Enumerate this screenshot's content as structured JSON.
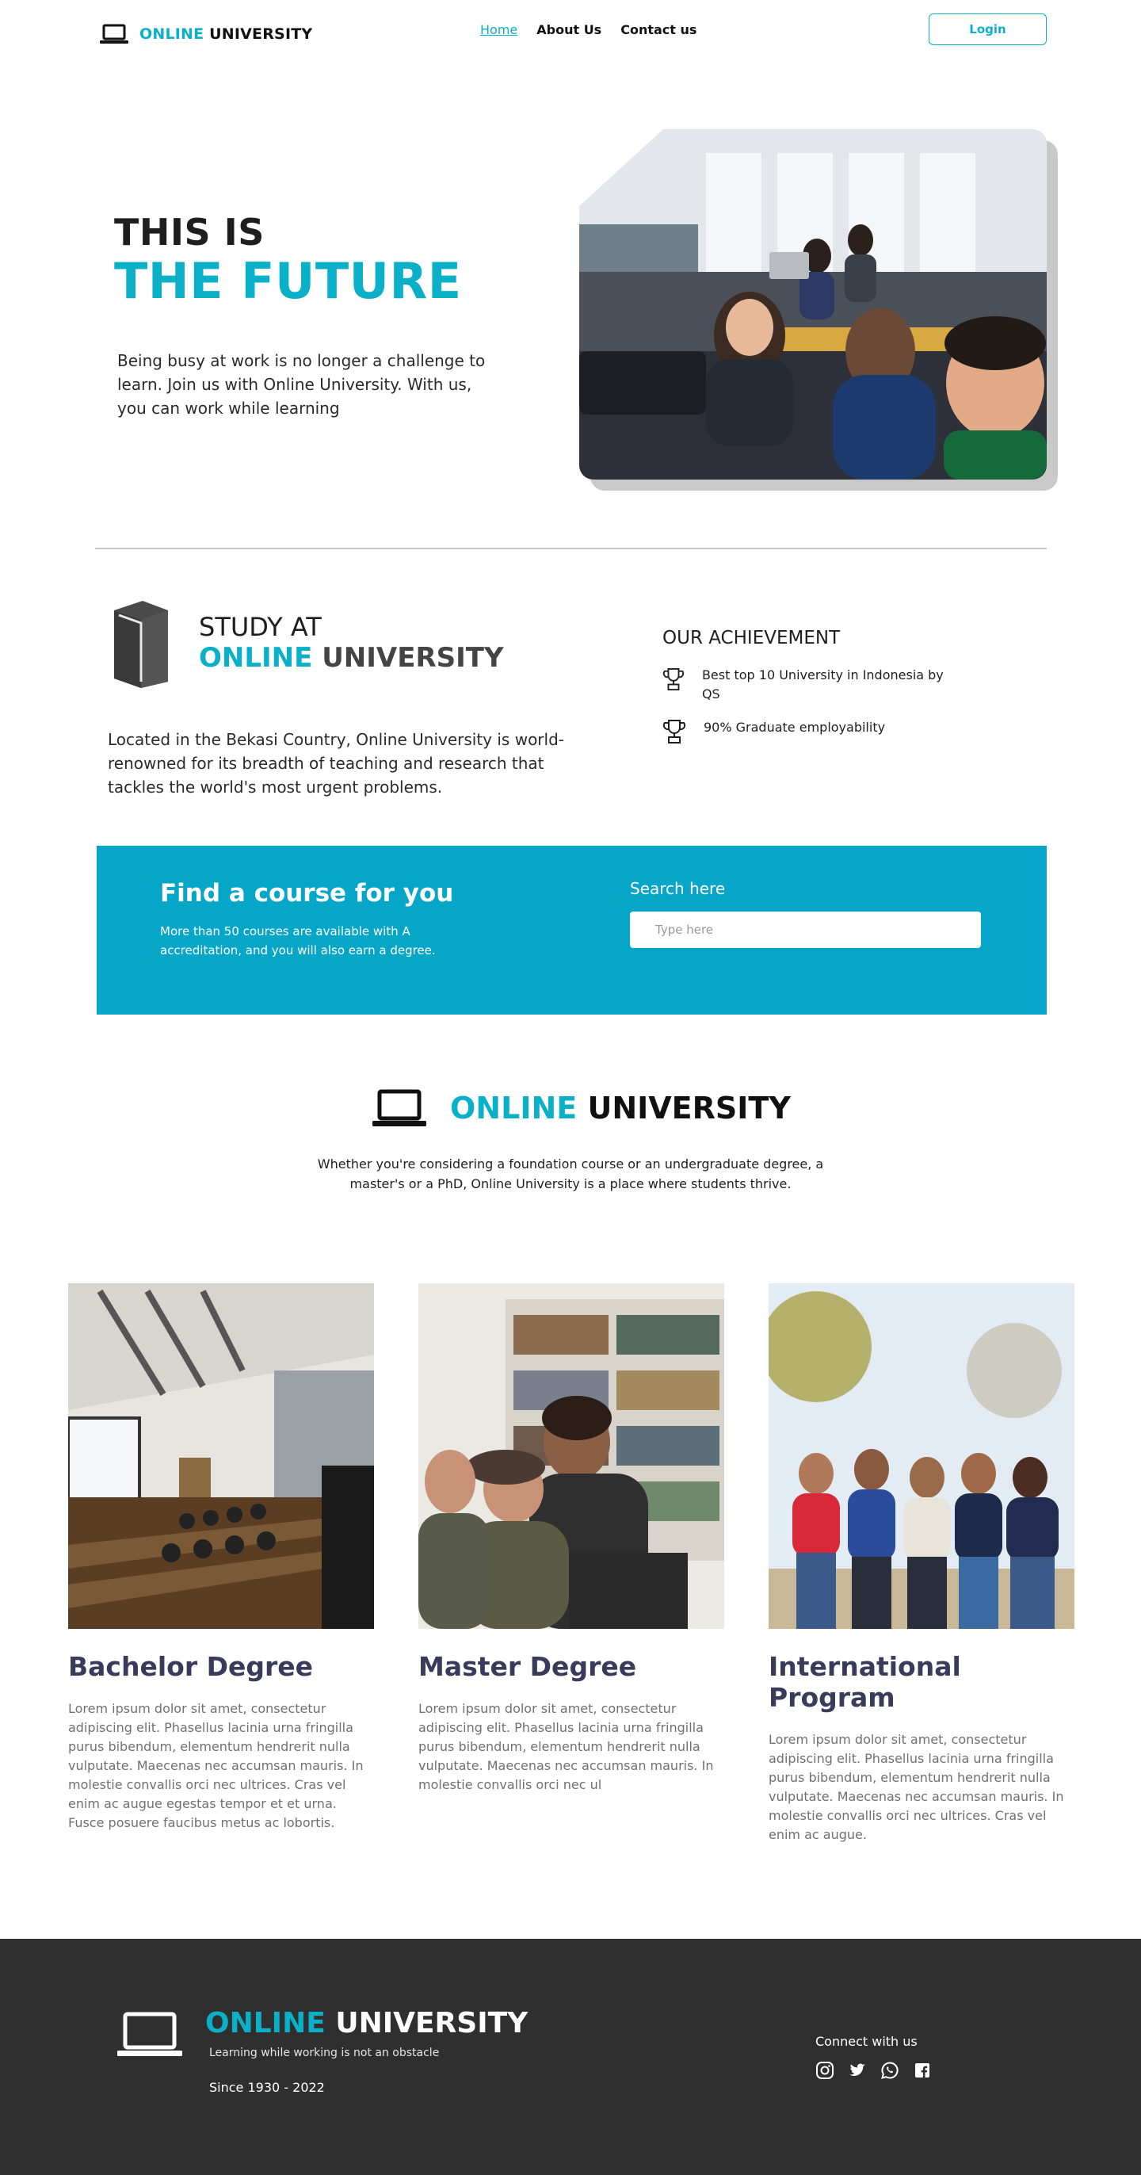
{
  "nav": {
    "brand_accent": "ONLINE",
    "brand_rest": "UNIVERSITY",
    "links": [
      "Home",
      "About Us",
      "Contact us"
    ],
    "active_link": "Home",
    "login_label": "Login",
    "logo_icon": "laptop-icon"
  },
  "hero": {
    "pre_title": "THIS IS",
    "title": "THE FUTURE",
    "description": "Being busy at work is no longer a challenge to learn. Join us with Online University. With us, you can work while learning"
  },
  "study": {
    "icon": "book-icon",
    "pre_title": "STUDY AT",
    "title_accent": "ONLINE",
    "title_rest": "UNIVERSITY",
    "description": "Located in the Bekasi Country, Online University is world-renowned for its breadth of teaching and research that tackles the world's most urgent problems."
  },
  "achievement": {
    "title": "OUR ACHIEVEMENT",
    "icon": "trophy-icon",
    "items": [
      "Best top 10 University in Indonesia by QS",
      "90% Graduate employability"
    ]
  },
  "course": {
    "title": "Find a course for you",
    "description": "More than 50 courses are available with A accreditation, and you will also earn a degree.",
    "search_label": "Search here",
    "search_placeholder": "Type here"
  },
  "about": {
    "brand_accent": "ONLINE",
    "brand_rest": "UNIVERSITY",
    "description": "Whether you're considering a foundation course or an undergraduate degree, a master's or a PhD, Online University is a place where students thrive."
  },
  "programs": [
    {
      "title": "Bachelor Degree",
      "text": "Lorem ipsum dolor sit amet, consectetur adipiscing elit. Phasellus lacinia urna fringilla purus bibendum, elementum hendrerit nulla vulputate. Maecenas nec accumsan mauris. In molestie convallis orci nec ultrices. Cras vel enim ac augue egestas tempor et et urna. Fusce posuere faucibus metus ac lobortis."
    },
    {
      "title": "Master Degree",
      "text": "Lorem ipsum dolor sit amet, consectetur adipiscing elit. Phasellus lacinia urna fringilla purus bibendum, elementum hendrerit nulla vulputate. Maecenas nec accumsan mauris. In molestie convallis orci nec ul"
    },
    {
      "title": "International Program",
      "text": "Lorem ipsum dolor sit amet, consectetur adipiscing elit. Phasellus lacinia urna fringilla purus bibendum, elementum hendrerit nulla vulputate. Maecenas nec accumsan mauris. In molestie convallis orci nec ultrices. Cras vel enim ac augue."
    }
  ],
  "footer": {
    "brand_accent": "ONLINE",
    "brand_rest": "UNIVERSITY",
    "tagline": "Learning while working is not an obstacle",
    "since": "Since 1930 - 2022",
    "connect_label": "Connect with us",
    "social_icons": [
      "instagram-icon",
      "twitter-icon",
      "whatsapp-icon",
      "facebook-icon"
    ]
  },
  "colors": {
    "accent": "#0ab0c8",
    "band": "#06a6c9",
    "footer_bg": "#2f2f2f",
    "program_title": "#3a3a5a"
  }
}
